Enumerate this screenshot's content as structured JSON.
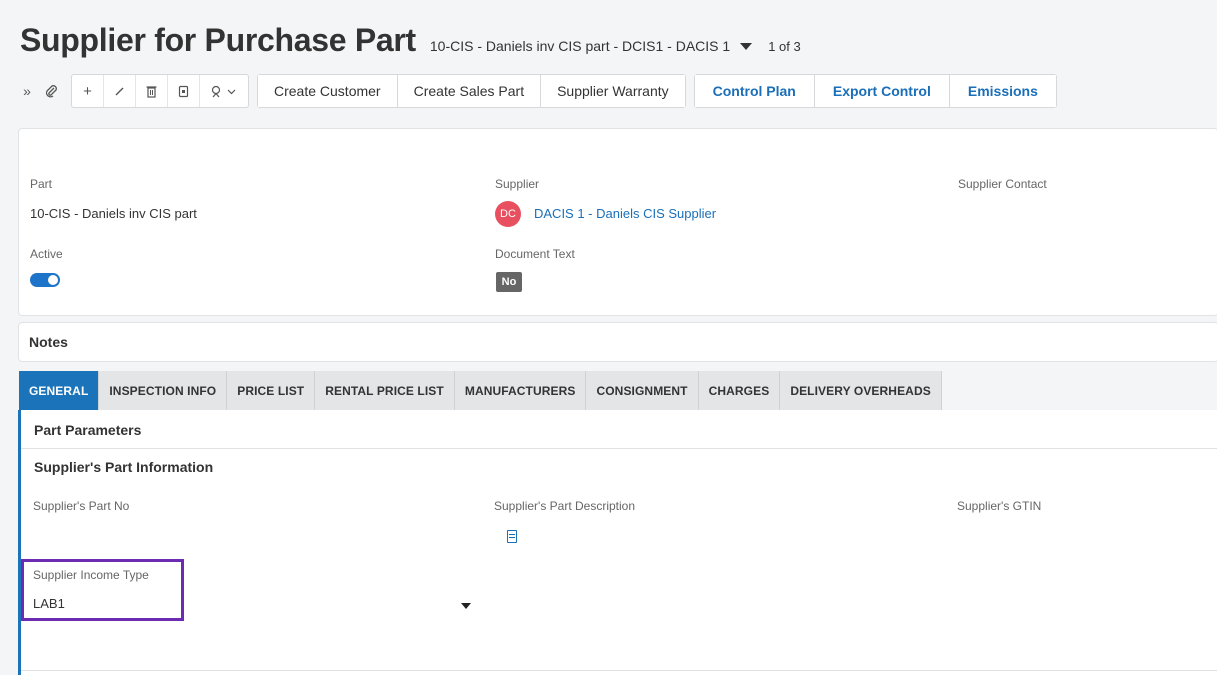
{
  "header": {
    "title": "Supplier for Purchase Part",
    "record": "10-CIS - Daniels inv CIS part - DCIS1 - DACIS 1",
    "record_count": "1 of 3"
  },
  "toolbar": {
    "actions": [
      "Create Customer",
      "Create Sales Part",
      "Supplier Warranty"
    ],
    "links": [
      "Control Plan",
      "Export Control",
      "Emissions"
    ],
    "icons": [
      "expand-icon",
      "attachment-icon",
      "add-icon",
      "edit-icon",
      "delete-icon",
      "duplicate-icon",
      "follow-icon"
    ]
  },
  "details": {
    "part_label": "Part",
    "part_value": "10-CIS - Daniels inv CIS part",
    "supplier_label": "Supplier",
    "supplier_initials": "DC",
    "supplier_value": "DACIS 1 - Daniels CIS Supplier",
    "supplier_contact_label": "Supplier Contact",
    "active_label": "Active",
    "active_value": true,
    "document_text_label": "Document Text",
    "document_text_value": "No"
  },
  "notes": {
    "title": "Notes"
  },
  "tabs": [
    {
      "label": "GENERAL",
      "active": true
    },
    {
      "label": "INSPECTION INFO",
      "active": false
    },
    {
      "label": "PRICE LIST",
      "active": false
    },
    {
      "label": "RENTAL PRICE LIST",
      "active": false
    },
    {
      "label": "MANUFACTURERS",
      "active": false
    },
    {
      "label": "CONSIGNMENT",
      "active": false
    },
    {
      "label": "CHARGES",
      "active": false
    },
    {
      "label": "DELIVERY OVERHEADS",
      "active": false
    }
  ],
  "general": {
    "part_parameters": "Part Parameters",
    "suppliers_part_info": "Supplier's Part Information",
    "suppliers_part_no_label": "Supplier's Part No",
    "suppliers_part_desc_label": "Supplier's Part Description",
    "suppliers_gtin_label": "Supplier's GTIN",
    "income_type_label": "Supplier Income Type",
    "income_type_value": "LAB1"
  },
  "colors": {
    "accent": "#1b73b9",
    "link": "#1a6fb8",
    "avatar": "#e8505f",
    "highlight": "#6c2bb0"
  }
}
